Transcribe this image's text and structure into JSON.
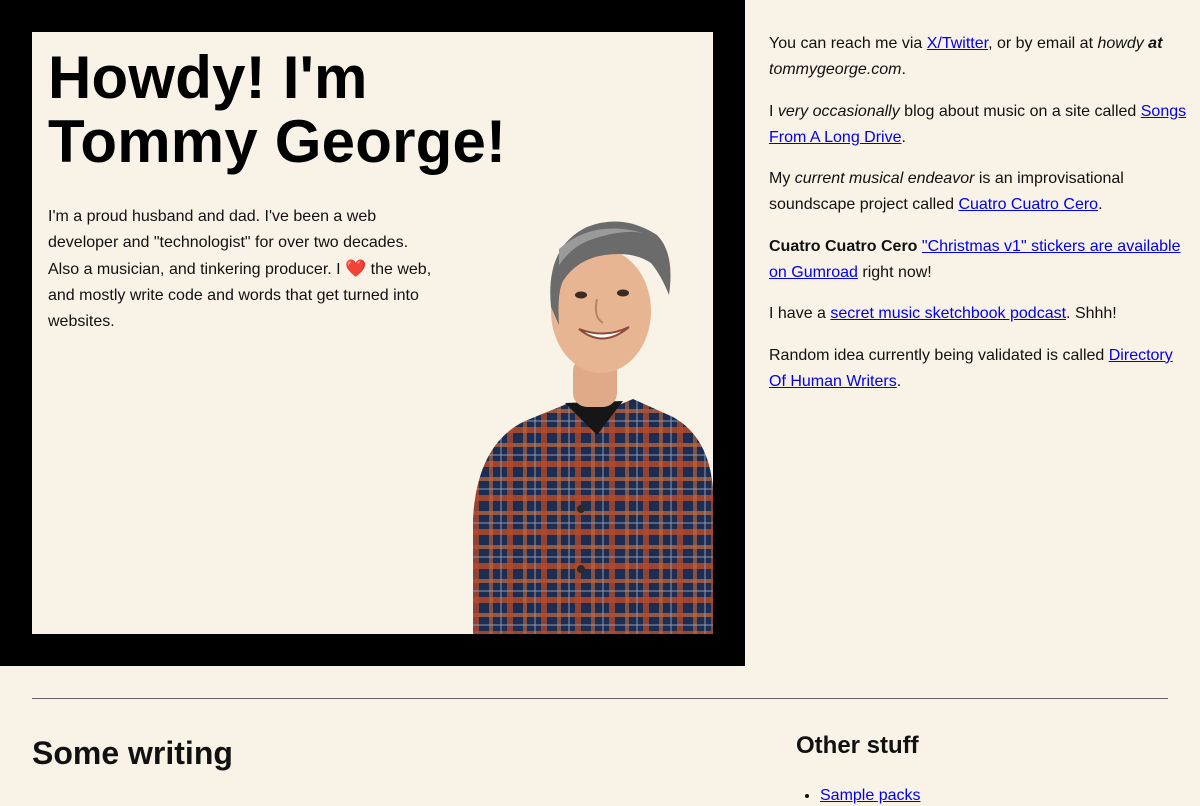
{
  "hero": {
    "title_line1": "Howdy! I'm",
    "title_line2": "Tommy George!",
    "intro_before_heart": "I'm a proud husband and dad. I've been a web developer and \"technologist\" for over two decades. Also a musician, and tinkering producer. I ",
    "heart": "❤️",
    "intro_after_heart": " the web, and mostly write code and words that get turned into websites."
  },
  "contact": {
    "prefix": "You can reach me via ",
    "twitter_link": "X/Twitter",
    "middle": ", or by email at ",
    "email_user": "howdy",
    "email_at": "at",
    "email_domain": "tommygeorge.com",
    "suffix": "."
  },
  "blog": {
    "prefix": "I ",
    "emphasis": "very occasionally",
    "middle": " blog about music on a site called ",
    "link": "Songs From A Long Drive",
    "suffix": "."
  },
  "music": {
    "prefix": "My ",
    "emphasis": "current musical endeavor",
    "middle": " is an improvisational soundscape project called ",
    "link": "Cuatro Cuatro Cero",
    "suffix": "."
  },
  "stickers": {
    "bold": "Cuatro Cuatro Cero",
    "space": " ",
    "link": "\"Christmas v1\" stickers are available on Gumroad",
    "suffix": " right now!"
  },
  "podcast": {
    "prefix": "I have a ",
    "link": "secret music sketchbook podcast",
    "suffix": ". Shhh!"
  },
  "idea": {
    "prefix": "Random idea currently being validated is called ",
    "link": "Directory Of Human Writers",
    "suffix": "."
  },
  "writing": {
    "title": "Some writing"
  },
  "other": {
    "title": "Other stuff",
    "items": [
      "Sample packs"
    ]
  },
  "colors": {
    "background": "#f9f2e6",
    "frame": "#000000",
    "link": "#0000ee"
  }
}
